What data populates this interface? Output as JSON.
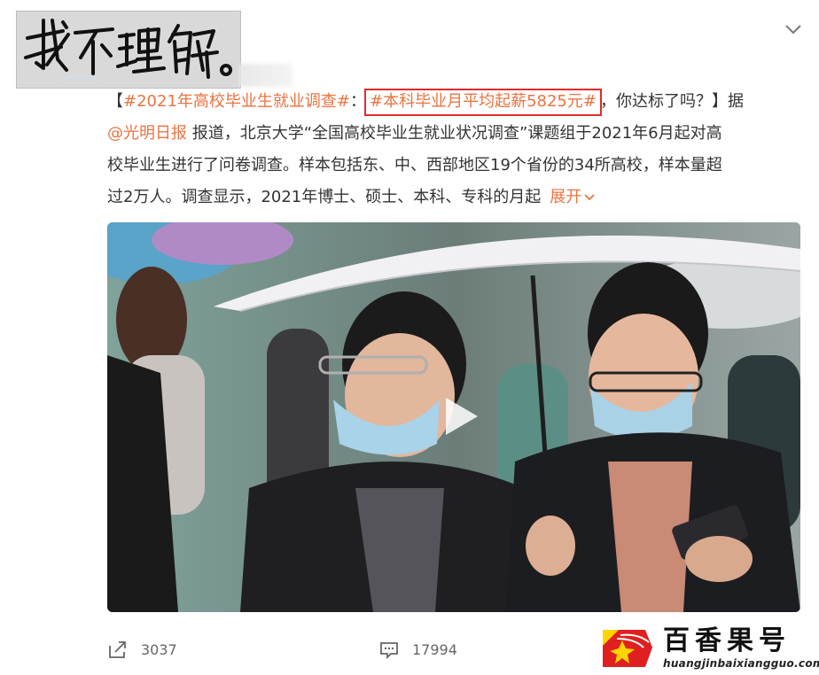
{
  "sticker": {
    "handwriting": "我不理解。"
  },
  "post": {
    "bracket_open": "【",
    "tag1": "#2021年高校毕业生就业调查#",
    "colon": "：",
    "tag2": "#本科毕业月平均起薪5825元#",
    "line1_tail": "，你达标了吗？】据",
    "mention": "@光明日报",
    "line2_tail": " 报道，北京大学“全国高校毕业生就业状况调查”课题组于2021年6月起对高",
    "line3": "校毕业生进行了问卷调查。样本包括东、中、西部地区19个省份的34所高校，样本量超",
    "line4": "过2万人。调查显示，2021年博士、硕士、本科、专科的月起",
    "expand": "展开"
  },
  "media": {
    "type": "video",
    "play_icon": "play-icon"
  },
  "actions": {
    "share_count": "3037",
    "comment_count": "17994"
  },
  "watermark": {
    "title": "百香果号",
    "url": "huangjinbaixiangguo.com"
  },
  "colors": {
    "link": "#eb7340",
    "highlight_box": "#e02b2b",
    "text": "#333333",
    "meta": "#666666"
  }
}
